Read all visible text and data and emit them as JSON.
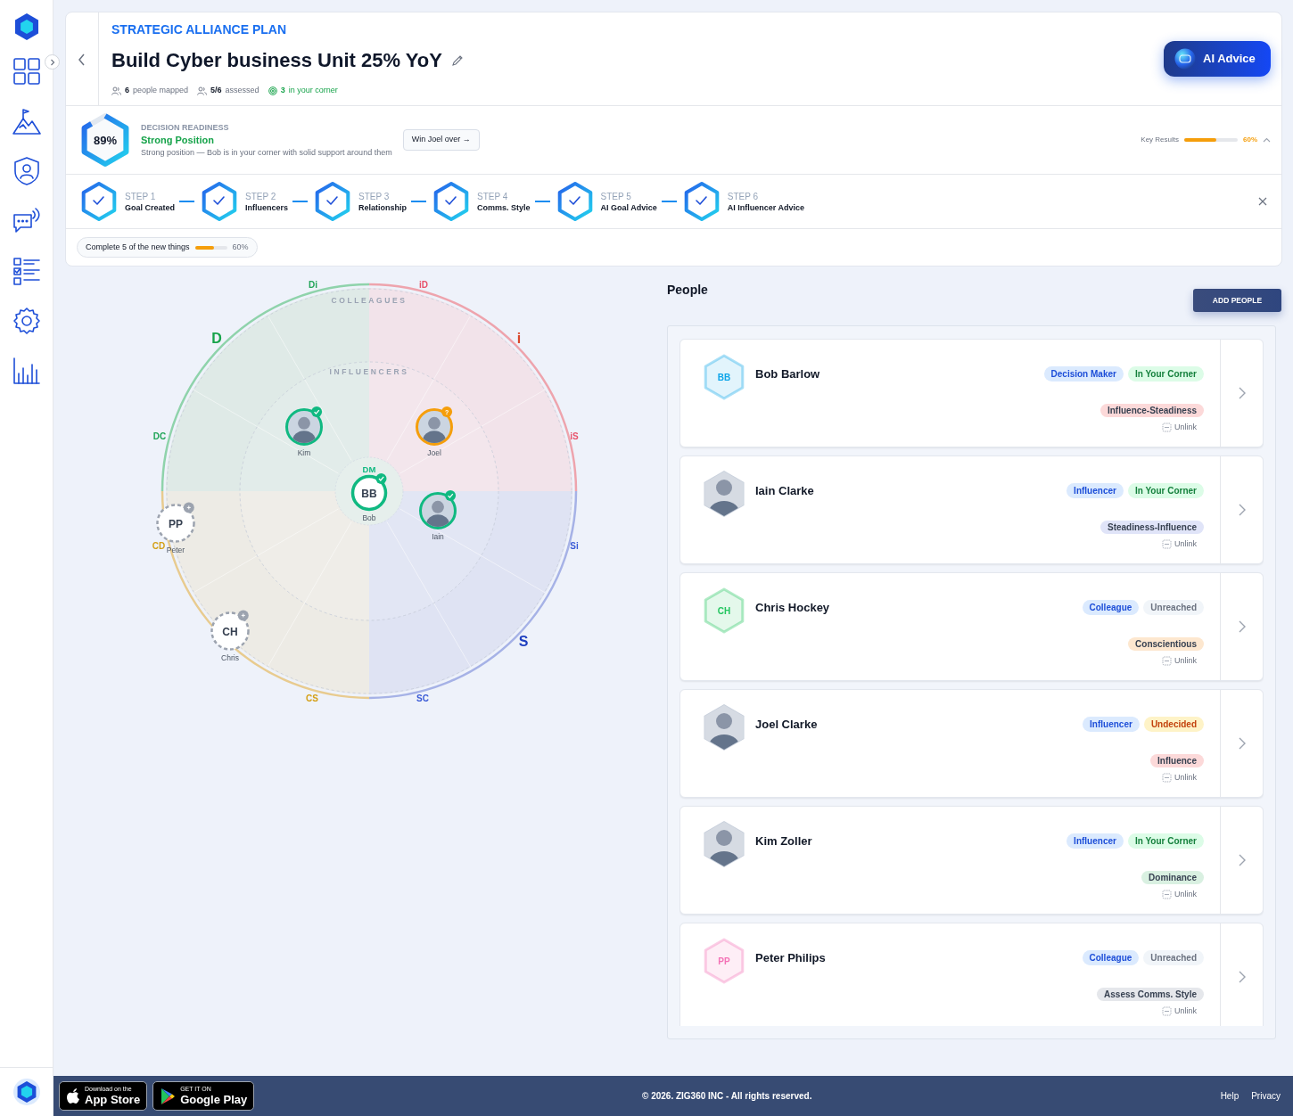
{
  "plan": {
    "eyebrow": "STRATEGIC ALLIANCE PLAN",
    "title": "Build Cyber business Unit 25% YoY",
    "stats": [
      {
        "kind": "people",
        "value": "6",
        "label": "people mapped"
      },
      {
        "kind": "people",
        "value": "5/6",
        "label": "assessed"
      },
      {
        "kind": "corner",
        "value": "3",
        "label": "in your corner"
      }
    ]
  },
  "ai_button": "AI Advice",
  "readiness": {
    "score": "89%",
    "level": 0.89,
    "heading": "DECISION READINESS",
    "status": "Strong Position",
    "description": "Strong position — Bob is in your corner with solid support around them",
    "action": "Win Joel over →"
  },
  "key_results": {
    "label": "Key Results",
    "level": 0.6,
    "reading": "60%",
    "expanded": true
  },
  "steps": [
    {
      "number": "STEP 1",
      "label": "Goal Created",
      "done": true
    },
    {
      "number": "STEP 2",
      "label": "Influencers",
      "done": true
    },
    {
      "number": "STEP 3",
      "label": "Relationship",
      "done": true
    },
    {
      "number": "STEP 4",
      "label": "Comms. Style",
      "done": true
    },
    {
      "number": "STEP 5",
      "label": "AI Goal Advice",
      "done": true
    },
    {
      "number": "STEP 6",
      "label": "AI Influencer Advice",
      "done": true
    }
  ],
  "progress": {
    "label": "Complete 5 of the new things",
    "level": 0.6,
    "reading": "60%"
  },
  "wheel": {
    "rings": [
      "COLLEAGUES",
      "INFLUENCERS"
    ],
    "style_labels": [
      {
        "label": "Di",
        "color": "#22a559"
      },
      {
        "label": "iD",
        "color": "#e8536b"
      },
      {
        "label": "D",
        "color": "#16a34a"
      },
      {
        "label": "i",
        "color": "#d9472b"
      },
      {
        "label": "DC",
        "color": "#22a559"
      },
      {
        "label": "iS",
        "color": "#e8536b"
      },
      {
        "label": "CD",
        "color": "#d4a017"
      },
      {
        "label": "Si",
        "color": "#3b5bd6"
      },
      {
        "label": "S",
        "color": "#1e3fbf"
      },
      {
        "label": "CS",
        "color": "#d4a017"
      },
      {
        "label": "SC",
        "color": "#3b5bd6"
      }
    ],
    "nodes": [
      {
        "name": "Bob",
        "avatar": {
          "kind": "initials",
          "initials": "BB"
        },
        "tag": "DM",
        "kind": "supporter"
      },
      {
        "name": "Kim",
        "avatar": {
          "kind": "photo"
        },
        "kind": "supporter"
      },
      {
        "name": "Joel",
        "avatar": {
          "kind": "photo"
        },
        "kind": "undecided",
        "badge": "?"
      },
      {
        "name": "Iain",
        "avatar": {
          "kind": "photo"
        },
        "kind": "supporter"
      },
      {
        "name": "Peter",
        "avatar": {
          "kind": "initials",
          "initials": "PP"
        },
        "kind": "unreached"
      },
      {
        "name": "Chris",
        "avatar": {
          "kind": "initials",
          "initials": "CH"
        },
        "kind": "unreached"
      }
    ]
  },
  "people": {
    "title": "People",
    "add_button": "ADD PEOPLE",
    "cards": [
      {
        "name": "Bob Barlow",
        "avatar": {
          "kind": "initials",
          "initials": "BB",
          "color": "#0ea5e9"
        },
        "role": "Decision Maker",
        "status": {
          "kind": "corner",
          "label": "In Your Corner"
        },
        "style": {
          "label": "Influence-Steadiness",
          "color": "#fcd9d9"
        },
        "action": "Unlink"
      },
      {
        "name": "Iain Clarke",
        "avatar": {
          "kind": "photo"
        },
        "role": "Influencer",
        "status": {
          "kind": "corner",
          "label": "In Your Corner"
        },
        "style": {
          "label": "Steadiness-Influence",
          "color": "#e0e4f8"
        },
        "action": "Unlink"
      },
      {
        "name": "Chris Hockey",
        "avatar": {
          "kind": "initials",
          "initials": "CH",
          "color": "#22c55e"
        },
        "role": "Colleague",
        "status": {
          "kind": "unreached",
          "label": "Unreached"
        },
        "style": {
          "label": "Conscientious",
          "color": "#fde7cf"
        },
        "action": "Unlink"
      },
      {
        "name": "Joel Clarke",
        "avatar": {
          "kind": "photo"
        },
        "role": "Influencer",
        "status": {
          "kind": "undecided",
          "label": "Undecided"
        },
        "style": {
          "label": "Influence",
          "color": "#fcd9d9"
        },
        "action": "Unlink"
      },
      {
        "name": "Kim Zoller",
        "avatar": {
          "kind": "photo"
        },
        "role": "Influencer",
        "status": {
          "kind": "corner",
          "label": "In Your Corner"
        },
        "style": {
          "label": "Dominance",
          "color": "#d9f0e1"
        },
        "action": "Unlink"
      },
      {
        "name": "Peter Philips",
        "avatar": {
          "kind": "initials",
          "initials": "PP",
          "color": "#f472b6"
        },
        "role": "Colleague",
        "status": {
          "kind": "unreached",
          "label": "Unreached"
        },
        "style": {
          "label": "Assess Comms. Style",
          "color": "#e5e7eb"
        },
        "action": "Unlink"
      }
    ]
  },
  "footer": {
    "app_store": {
      "small": "Download on the",
      "large": "App Store"
    },
    "google_play": {
      "small": "GET IT ON",
      "large": "Google Play"
    },
    "copyright": "© 2026. ZIG360 INC - All rights reserved.",
    "links": [
      "Help",
      "Privacy"
    ]
  }
}
